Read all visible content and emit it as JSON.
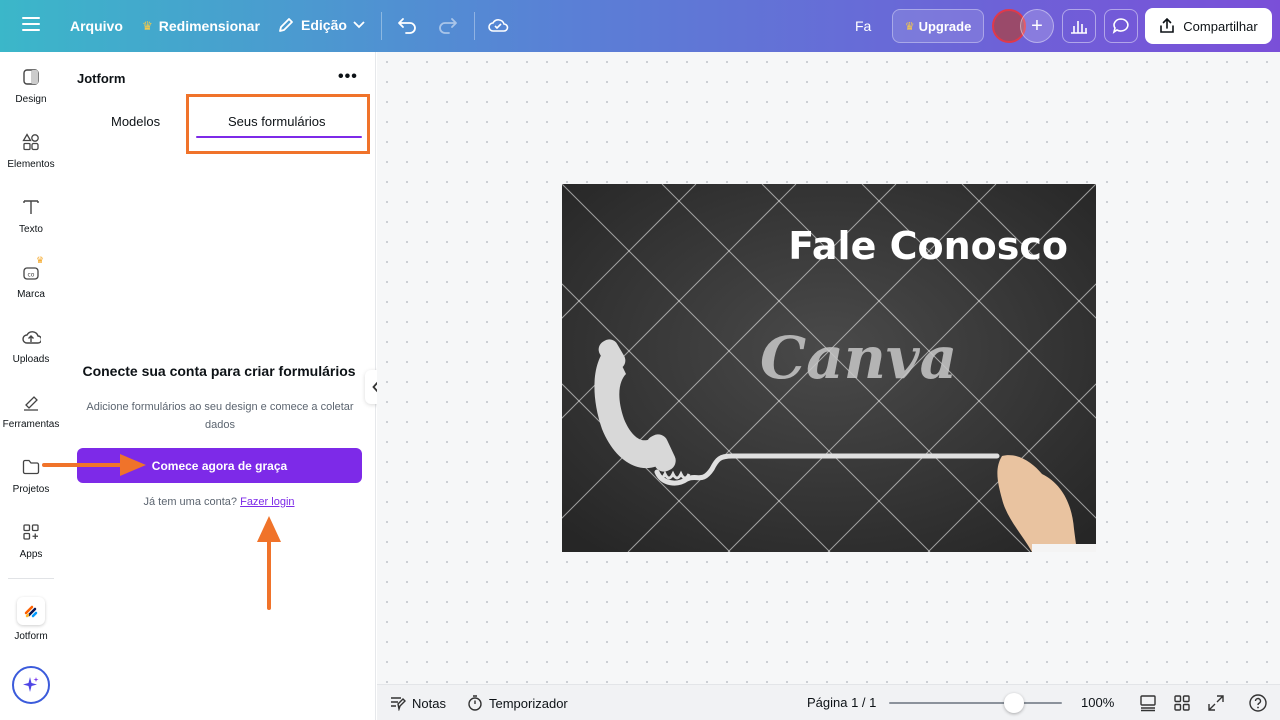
{
  "topbar": {
    "menu_icon": "hamburger-icon",
    "file_label": "Arquivo",
    "resize_label": "Redimensionar",
    "edit_label": "Edição",
    "user_initials": "Fa",
    "upgrade_label": "Upgrade",
    "share_label": "Compartilhar"
  },
  "rail": {
    "items": [
      {
        "label": "Design",
        "icon": "design-icon"
      },
      {
        "label": "Elementos",
        "icon": "elements-icon"
      },
      {
        "label": "Texto",
        "icon": "text-icon"
      },
      {
        "label": "Marca",
        "icon": "brand-icon"
      },
      {
        "label": "Uploads",
        "icon": "upload-icon"
      },
      {
        "label": "Ferramentas",
        "icon": "tools-icon"
      },
      {
        "label": "Projetos",
        "icon": "folder-icon"
      },
      {
        "label": "Apps",
        "icon": "apps-icon"
      },
      {
        "label": "Jotform",
        "icon": "jotform-icon"
      }
    ]
  },
  "panel": {
    "title": "Jotform",
    "tabs": [
      {
        "label": "Modelos"
      },
      {
        "label": "Seus formulários",
        "active": true
      }
    ],
    "heading": "Conecte sua conta para criar formulários",
    "subtext": "Adicione formulários ao seu design e comece a coletar dados",
    "cta_label": "Comece agora de graça",
    "login_prompt": "Já tem uma conta?",
    "login_link": "Fazer login"
  },
  "design": {
    "headline": "Fale Conosco",
    "watermark": "Canva"
  },
  "bottombar": {
    "notes_label": "Notas",
    "timer_label": "Temporizador",
    "page_label": "Página 1 / 1",
    "zoom_label": "100%",
    "zoom_percent": 100
  },
  "colors": {
    "accent": "#7d2ae8",
    "annotation": "#f0732a"
  }
}
